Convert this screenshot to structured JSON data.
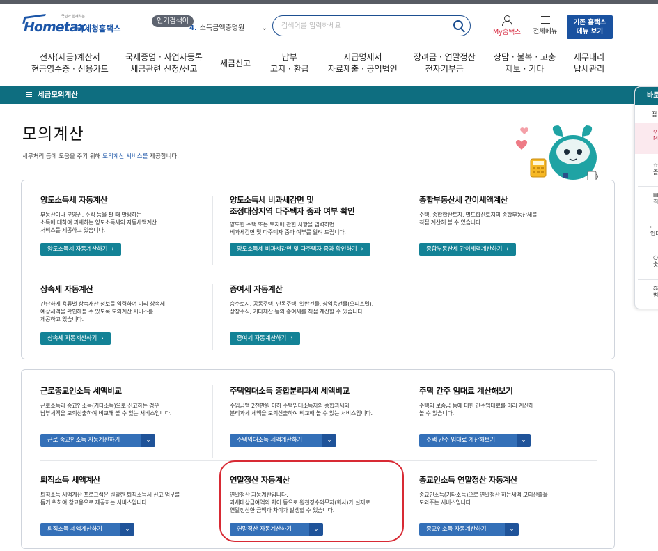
{
  "header": {
    "logo_slogan": "국민과 함께하는",
    "logo_word": "Hometax",
    "logo_kr": "국세청홈택스",
    "popular_badge": "인기검색어",
    "popular_rank": "4.",
    "popular_term": "소득금액증명원",
    "search_placeholder": "검색어를 입력하세요",
    "my_hometax": "My홈택스",
    "all_menu": "전체메뉴",
    "old_menu_line1": "기존 홈택스",
    "old_menu_line2": "메뉴 보기"
  },
  "gnb": [
    {
      "line1": "전자(세금)계산서",
      "line2": "현금영수증 · 신용카드"
    },
    {
      "line1": "국세증명 · 사업자등록",
      "line2": "세금관련 신청/신고"
    },
    {
      "line1": "세금신고",
      "line2": ""
    },
    {
      "line1": "납부",
      "line2": "고지 · 환급"
    },
    {
      "line1": "지급명세서",
      "line2": "자료제출 · 공익법인"
    },
    {
      "line1": "장려금 · 연말정산",
      "line2": "전자기부금"
    },
    {
      "line1": "상담 · 불복 · 고충",
      "line2": "제보 · 기타"
    },
    {
      "line1": "세무대리",
      "line2": "납세관리"
    }
  ],
  "subbar": {
    "menu_label": "세금모의계산"
  },
  "quick": {
    "head": "바로",
    "items": [
      "접",
      "My",
      "즐거",
      "최근",
      "인터넷",
      "숫돌",
      "법령"
    ]
  },
  "page": {
    "title": "모의계산",
    "desc_before": "세무처리 등에 도움을 주기 위해 ",
    "desc_highlight": "모의계산 서비스를",
    "desc_after": " 제공합니다."
  },
  "panel1": {
    "cards": [
      {
        "title": "양도소득세 자동계산",
        "desc": [
          "부동산이나 분양권, 주식 등을 팔 때 발생하는",
          "소득에 대하여 과세하는 양도소득세의 자동세액계산",
          "서비스를 제공하고 있습니다."
        ],
        "button": "양도소득세 자동계산하기"
      },
      {
        "title_line1": "양도소득세 비과세감면 및",
        "title_line2": "조정대상지역 다주택자 중과 여부 확인",
        "desc": [
          "양도한 주택 또는 토지에 관한 사항을 입력하면",
          "비과세감면 및 다주택자 중과 여부를 알려 드립니다."
        ],
        "button": "양도소득세 비과세감면 및 다주택자 중과 확인하기"
      },
      {
        "title": "종합부동산세 간이세액계산",
        "desc": [
          "주택, 종합합산토지, 별도합산토지의 종합부동산세를",
          "직접 계산해 볼 수 있습니다."
        ],
        "button": "종합부동산세 간이세액계산하기"
      },
      {
        "title": "상속세 자동계산",
        "desc": [
          "간단하게 용류별 상속재산 정보를 입력하여 미리 상속세",
          "예상세액을 확인해볼 수 있도록 모의계산 서비스를",
          "제공하고 있습니다."
        ],
        "button": "상속세 자동계산하기"
      },
      {
        "title": "증여세 자동계산",
        "desc": [
          "승수토지, 공동주택, 단독주택, 일반건물, 상업용건물(오피스텔),",
          "상장주식, 기타재산 등의 증여세를 직접 계산할 수 있습니다."
        ],
        "button": "증여세 자동계산하기"
      }
    ]
  },
  "panel2": {
    "cards": [
      {
        "title": "근로종교인소득 세액비교",
        "desc": [
          "근로소득과 종교인소득(기타소득)으로 신고하는 경우",
          "납부세액을 모의산출하여 비교해 볼 수 있는 서비스입니다."
        ],
        "button": "근로 종교인소득 자동계산하기"
      },
      {
        "title": "주택임대소득 종합분리과세 세액비교",
        "desc": [
          "수입금액 2천만원 이하 주택임대소득자의 종합과세와",
          "분리과세 세액을 모의산출하여 비교해 볼 수 있는 서비스입니다."
        ],
        "button": "주택임대소득 세액계산하기"
      },
      {
        "title": "주택 간주 임대료 계산해보기",
        "desc": [
          "주택의 보증금 등에 대한 간주임대료를 미리 계산해",
          "볼 수 있습니다."
        ],
        "button": "주택 간주 임대료 계산해보기"
      },
      {
        "title": "퇴직소득 세액계산",
        "desc": [
          "퇴직소득 세액계산 프로그램은 원활한 퇴직소득세 신고 업무를",
          "돕기 위하여 참고용으로 제공하는 서비스입니다."
        ],
        "button": "퇴직소득 세액계산하기"
      },
      {
        "title": "연말정산 자동계산",
        "desc": [
          "연말정산 자동계산입니다.",
          "과세대상급여액의 차이 등으로 원천징수의무자(회사)가 실제로",
          "연말정산한 금액과 차이가 발생할 수 있습니다."
        ],
        "button": "연말정산 자동계산하기"
      },
      {
        "title": "종교인소득 연말정산 자동계산",
        "desc": [
          "종교인소득(기타소득)으로 연말정산 하는세액 모의산출을",
          "도와주는 서비스입니다."
        ],
        "button": "종교인소득 자동계산하기"
      }
    ]
  },
  "colors": {
    "teal": "#0e6e80",
    "teal_button": "#138296",
    "blue_button": "#3470b8",
    "highlight_circle": "#d82a34"
  }
}
